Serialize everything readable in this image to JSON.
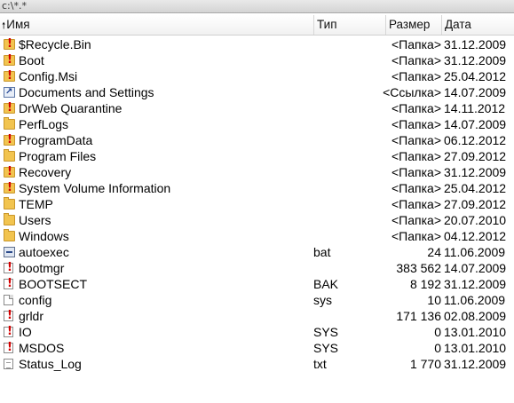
{
  "path": "c:\\*.*",
  "columns": {
    "name": "Имя",
    "type": "Тип",
    "size": "Размер",
    "date": "Дата",
    "sort_indicator": "up-arrow-icon"
  },
  "rows": [
    {
      "icon": "warn-folder",
      "name": "$Recycle.Bin",
      "type": "",
      "size": "<Папка>",
      "date": "31.12.2009"
    },
    {
      "icon": "warn-folder",
      "name": "Boot",
      "type": "",
      "size": "<Папка>",
      "date": "31.12.2009"
    },
    {
      "icon": "warn-folder",
      "name": "Config.Msi",
      "type": "",
      "size": "<Папка>",
      "date": "25.04.2012"
    },
    {
      "icon": "link",
      "name": "Documents and Settings",
      "type": "",
      "size": "<Ссылка>",
      "date": "14.07.2009"
    },
    {
      "icon": "warn-folder",
      "name": "DrWeb Quarantine",
      "type": "",
      "size": "<Папка>",
      "date": "14.11.2012"
    },
    {
      "icon": "folder",
      "name": "PerfLogs",
      "type": "",
      "size": "<Папка>",
      "date": "14.07.2009"
    },
    {
      "icon": "warn-folder",
      "name": "ProgramData",
      "type": "",
      "size": "<Папка>",
      "date": "06.12.2012"
    },
    {
      "icon": "folder",
      "name": "Program Files",
      "type": "",
      "size": "<Папка>",
      "date": "27.09.2012"
    },
    {
      "icon": "warn-folder",
      "name": "Recovery",
      "type": "",
      "size": "<Папка>",
      "date": "31.12.2009"
    },
    {
      "icon": "warn-folder",
      "name": "System Volume Information",
      "type": "",
      "size": "<Папка>",
      "date": "25.04.2012"
    },
    {
      "icon": "folder",
      "name": "TEMP",
      "type": "",
      "size": "<Папка>",
      "date": "27.09.2012"
    },
    {
      "icon": "folder",
      "name": "Users",
      "type": "",
      "size": "<Папка>",
      "date": "20.07.2010"
    },
    {
      "icon": "folder",
      "name": "Windows",
      "type": "",
      "size": "<Папка>",
      "date": "04.12.2012"
    },
    {
      "icon": "bat",
      "name": "autoexec",
      "type": "bat",
      "size": "24",
      "date": "11.06.2009"
    },
    {
      "icon": "warn-file",
      "name": "bootmgr",
      "type": "",
      "size": "383 562",
      "date": "14.07.2009"
    },
    {
      "icon": "warn-file",
      "name": "BOOTSECT",
      "type": "BAK",
      "size": "8 192",
      "date": "31.12.2009"
    },
    {
      "icon": "file",
      "name": "config",
      "type": "sys",
      "size": "10",
      "date": "11.06.2009"
    },
    {
      "icon": "warn-file",
      "name": "grldr",
      "type": "",
      "size": "171 136",
      "date": "02.08.2009"
    },
    {
      "icon": "warn-file",
      "name": "IO",
      "type": "SYS",
      "size": "0",
      "date": "13.01.2010"
    },
    {
      "icon": "warn-file",
      "name": "MSDOS",
      "type": "SYS",
      "size": "0",
      "date": "13.01.2010"
    },
    {
      "icon": "doc",
      "name": "Status_Log",
      "type": "txt",
      "size": "1 770",
      "date": "31.12.2009"
    }
  ]
}
